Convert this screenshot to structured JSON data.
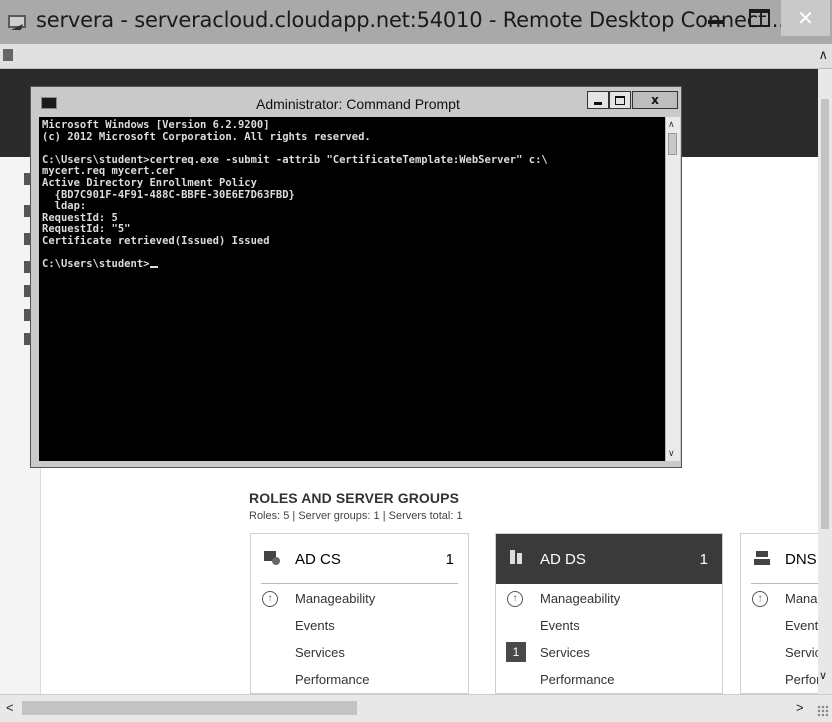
{
  "rdp_window": {
    "title": "servera - serveracloud.cloudapp.net:54010 - Remote Desktop Connecti...",
    "minimize_label": "",
    "close_glyph": "✕"
  },
  "cmd_window": {
    "title": "Administrator: Command Prompt",
    "close_glyph": "x",
    "lines": [
      "Microsoft Windows [Version 6.2.9200]",
      "(c) 2012 Microsoft Corporation. All rights reserved.",
      "",
      "C:\\Users\\student>certreq.exe -submit -attrib \"CertificateTemplate:WebServer\" c:\\",
      "mycert.req mycert.cer",
      "Active Directory Enrollment Policy",
      "  {BD7C901F-4F91-488C-BBFE-30E6E7D63FBD}",
      "  ldap:",
      "RequestId: 5",
      "RequestId: \"5\"",
      "Certificate retrieved(Issued) Issued",
      "",
      "C:\\Users\\student>"
    ]
  },
  "server_manager": {
    "roles_title": "ROLES AND SERVER GROUPS",
    "roles_summary": "Roles: 5  |  Server groups: 1  |  Servers total: 1",
    "tiles": [
      {
        "name": "AD CS",
        "count": "1",
        "rows": [
          "Manageability",
          "Events",
          "Services",
          "Performance"
        ],
        "services_badge": ""
      },
      {
        "name": "AD DS",
        "count": "1",
        "rows": [
          "Manageability",
          "Events",
          "Services",
          "Performance"
        ],
        "services_badge": "1"
      },
      {
        "name": "DNS",
        "count": "",
        "rows": [
          "Manageability",
          "Events",
          "Services",
          "Performance"
        ],
        "services_badge": ""
      }
    ]
  },
  "colors": {
    "console_bg": "#000000",
    "console_fg": "#dcdcdc",
    "tile_header_active": "#3a3a3a"
  },
  "icons": {
    "app": "remote-desktop-icon",
    "cmd": "cmd-icon",
    "manageability": "up-arrow-circle-icon"
  }
}
